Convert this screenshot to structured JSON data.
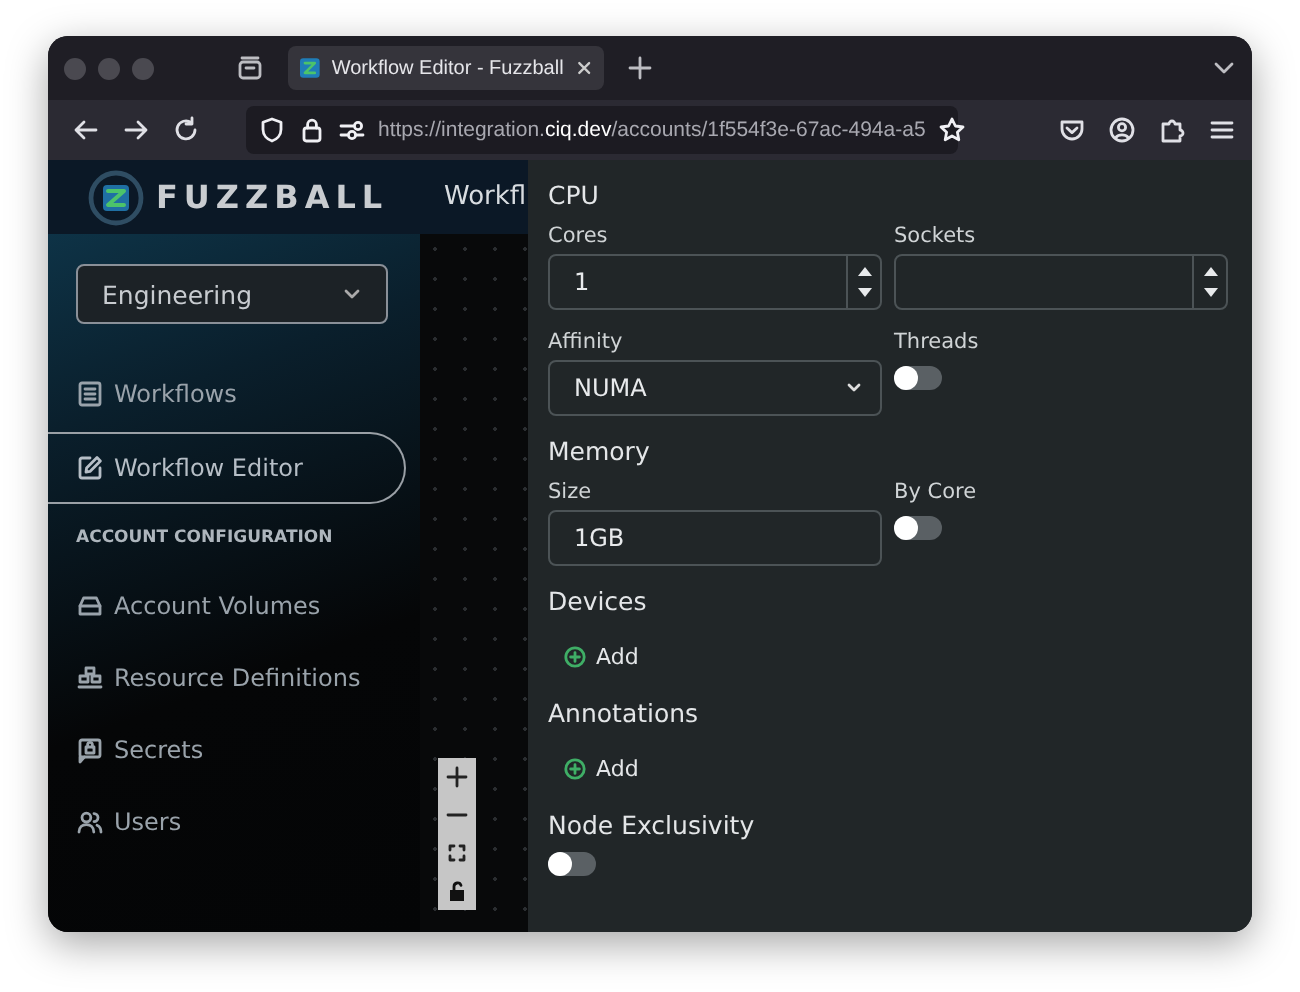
{
  "browser": {
    "tabs": [
      {
        "title": "Workflow Editor - Fuzzball",
        "selected": true
      }
    ],
    "url": "https://integration.**ciq.dev**/accounts/1f554f3e-67ac-494a-a5"
  },
  "sidebar": {
    "brand": "FUZZBALL",
    "account_select": "Engineering",
    "items": [
      {
        "kind": "link",
        "label": "Workflows",
        "selected": false
      },
      {
        "kind": "link",
        "label": "Workflow Editor",
        "selected": true
      },
      {
        "kind": "heading",
        "label": "ACCOUNT CONFIGURATION"
      },
      {
        "kind": "link",
        "label": "Account Volumes",
        "selected": false
      },
      {
        "kind": "link",
        "label": "Resource Definitions",
        "selected": false
      },
      {
        "kind": "link",
        "label": "Secrets",
        "selected": false
      },
      {
        "kind": "link",
        "label": "Users",
        "selected": false
      }
    ]
  },
  "canvas": {
    "title": "Workfl"
  },
  "panel": {
    "sections": [
      {
        "title": "CPU",
        "fields": [
          {
            "kind": "number",
            "label": "Cores",
            "value": "1"
          },
          {
            "kind": "number",
            "label": "Sockets"
          },
          {
            "kind": "select",
            "label": "Affinity",
            "value": "NUMA"
          },
          {
            "kind": "toggle",
            "label": "Threads",
            "on": false
          }
        ]
      },
      {
        "title": "Memory",
        "fields": [
          {
            "kind": "text",
            "label": "Size",
            "value": "1GB"
          },
          {
            "kind": "toggle",
            "label": "By Core",
            "on": false
          }
        ]
      },
      {
        "title": "Devices",
        "fields": [
          {
            "kind": "add",
            "label": "Add"
          }
        ]
      },
      {
        "title": "Annotations",
        "fields": [
          {
            "kind": "add",
            "label": "Add"
          }
        ]
      },
      {
        "title": "Node Exclusivity",
        "fields": [
          {
            "kind": "toggle",
            "on": false
          }
        ]
      }
    ]
  }
}
